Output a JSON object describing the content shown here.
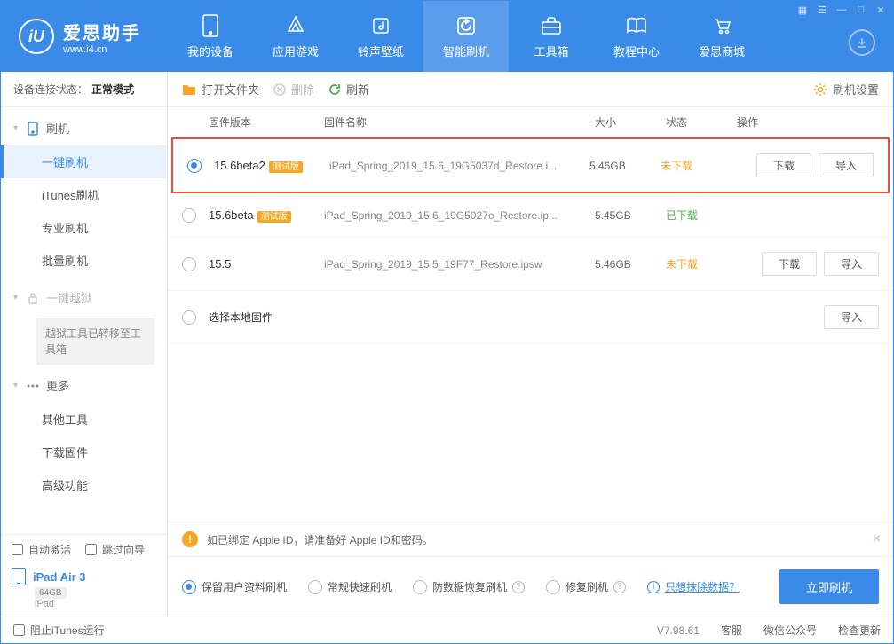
{
  "app": {
    "name": "爱思助手",
    "url": "www.i4.cn"
  },
  "nav": {
    "items": [
      {
        "label": "我的设备"
      },
      {
        "label": "应用游戏"
      },
      {
        "label": "铃声壁纸"
      },
      {
        "label": "智能刷机"
      },
      {
        "label": "工具箱"
      },
      {
        "label": "教程中心"
      },
      {
        "label": "爱思商城"
      }
    ]
  },
  "sidebar": {
    "status_label": "设备连接状态：",
    "status_mode": "正常模式",
    "flash": {
      "head": "刷机",
      "items": [
        "一键刷机",
        "iTunes刷机",
        "专业刷机",
        "批量刷机"
      ]
    },
    "jailbreak": {
      "head": "一键越狱",
      "note": "越狱工具已转移至工具箱"
    },
    "more": {
      "head": "更多",
      "items": [
        "其他工具",
        "下载固件",
        "高级功能"
      ]
    },
    "auto_activate": "自动激活",
    "skip_guide": "跳过向导",
    "device_name": "iPad Air 3",
    "device_storage": "64GB",
    "device_type": "iPad"
  },
  "toolbar": {
    "open_folder": "打开文件夹",
    "delete": "删除",
    "refresh": "刷新",
    "settings": "刷机设置"
  },
  "table": {
    "headers": {
      "version": "固件版本",
      "name": "固件名称",
      "size": "大小",
      "status": "状态",
      "action": "操作"
    },
    "rows": [
      {
        "version": "15.6beta2",
        "beta": "测试版",
        "name": "iPad_Spring_2019_15.6_19G5037d_Restore.i...",
        "size": "5.46GB",
        "status": "未下载",
        "status_class": "orange",
        "selected": true,
        "highlight": true,
        "download": "下载",
        "import": "导入"
      },
      {
        "version": "15.6beta",
        "beta": "测试版",
        "name": "iPad_Spring_2019_15.6_19G5027e_Restore.ip...",
        "size": "5.45GB",
        "status": "已下载",
        "status_class": "green",
        "selected": false
      },
      {
        "version": "15.5",
        "beta": "",
        "name": "iPad_Spring_2019_15.5_19F77_Restore.ipsw",
        "size": "5.46GB",
        "status": "未下载",
        "status_class": "orange",
        "selected": false,
        "download": "下载",
        "import": "导入"
      }
    ],
    "local": {
      "label": "选择本地固件",
      "import": "导入"
    }
  },
  "warn": {
    "text": "如已绑定 Apple ID，请准备好 Apple ID和密码。"
  },
  "options": {
    "o1": "保留用户资料刷机",
    "o2": "常规快速刷机",
    "o3": "防数据恢复刷机",
    "o4": "修复刷机",
    "erase_link": "只想抹除数据？",
    "flash_btn": "立即刷机"
  },
  "footer": {
    "block_itunes": "阻止iTunes运行",
    "version": "V7.98.61",
    "service": "客服",
    "wechat": "微信公众号",
    "update": "检查更新"
  }
}
